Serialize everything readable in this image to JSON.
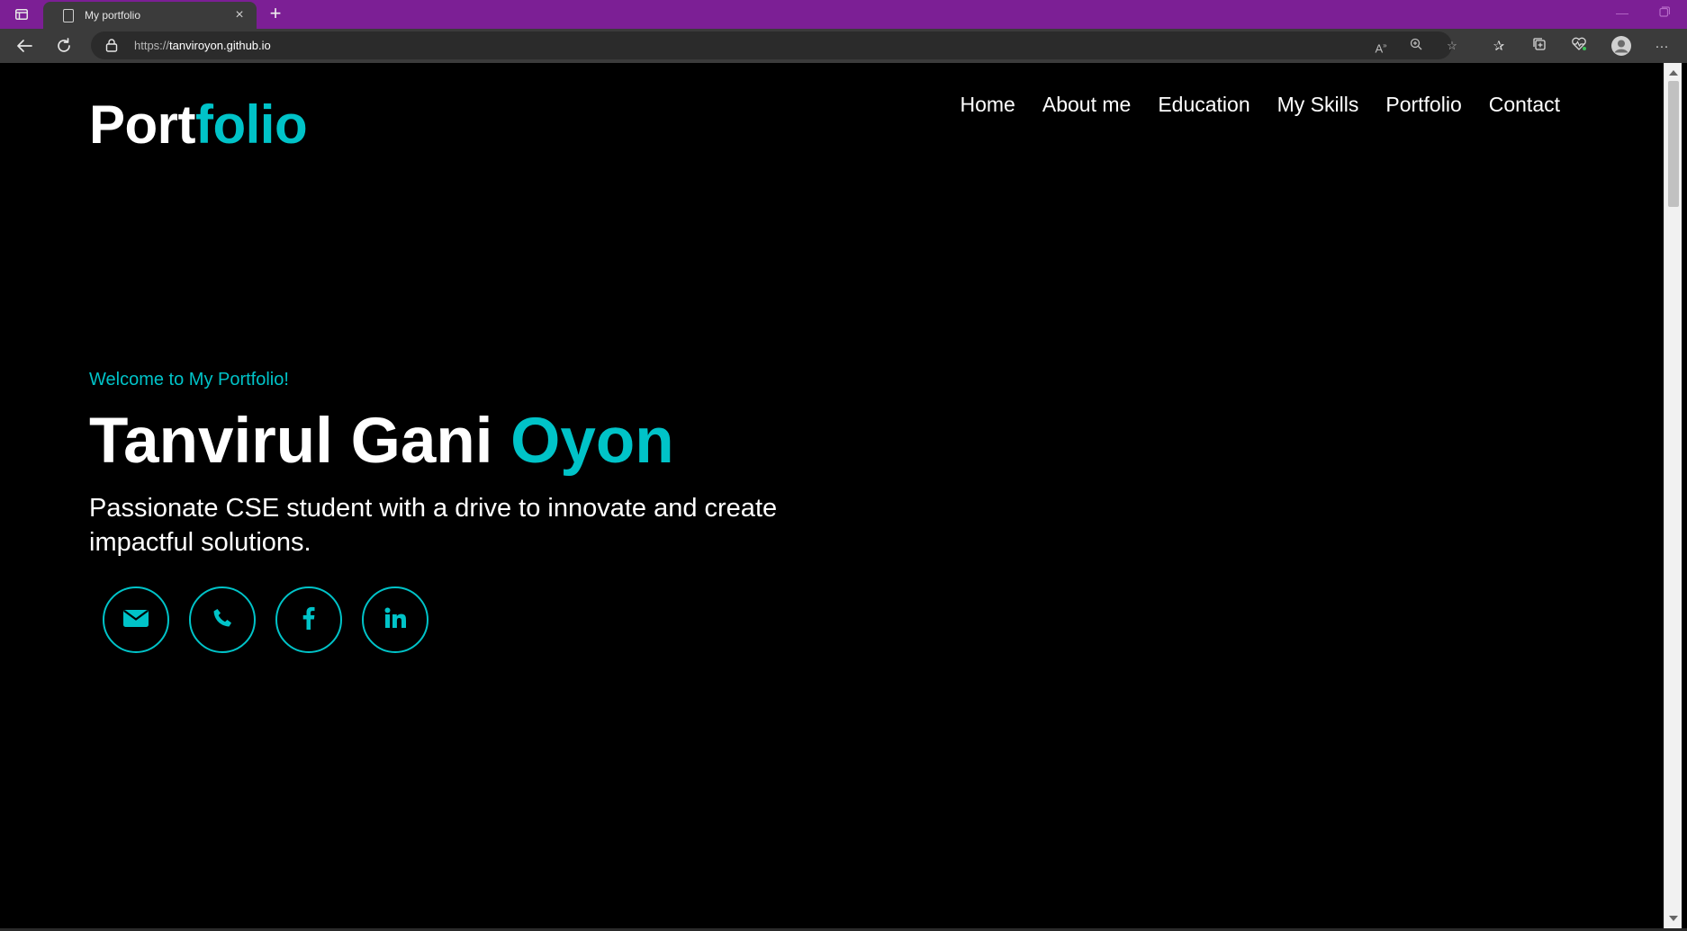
{
  "browser": {
    "tab_title": "My portfolio",
    "url_scheme": "https://",
    "url_host": "tanviroyon.github.io",
    "colors": {
      "titlebar": "#7c1f95",
      "toolbar": "#3b3b3b"
    }
  },
  "header": {
    "logo_primary": "Port",
    "logo_accent": "folio",
    "nav": [
      "Home",
      "About me",
      "Education",
      "My Skills",
      "Portfolio",
      "Contact"
    ]
  },
  "hero": {
    "welcome": "Welcome to My Portfolio!",
    "name_primary": "Tanvirul Gani ",
    "name_accent": "Oyon",
    "tagline": "Passionate CSE student with a drive to innovate and create impactful solutions.",
    "social_icons": [
      "envelope-icon",
      "phone-icon",
      "facebook-icon",
      "linkedin-icon"
    ]
  },
  "theme": {
    "accent": "#00c3c8",
    "background": "#000000",
    "text": "#ffffff"
  }
}
